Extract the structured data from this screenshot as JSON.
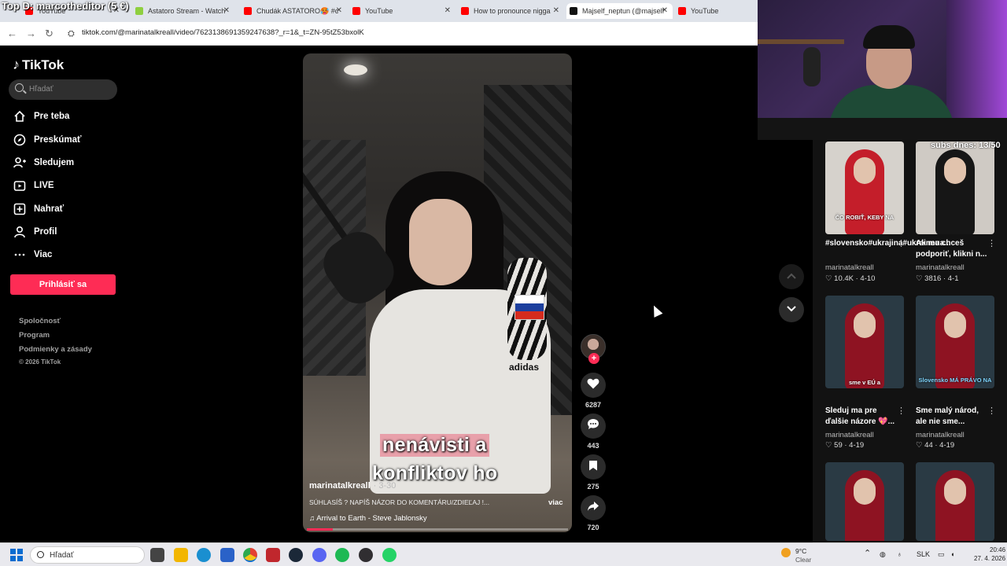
{
  "overlay": {
    "text": "Top D: marcotheditor (5 €)"
  },
  "browser": {
    "tabs": [
      {
        "title": "YouTube",
        "color": "#ff0000"
      },
      {
        "title": "Astatoro Stream - Watch",
        "color": "#8fcf3f"
      },
      {
        "title": "Chudák ASTATORO🥵 #c",
        "color": "#ff0000"
      },
      {
        "title": "YouTube",
        "color": "#ff0000"
      },
      {
        "title": "How to pronounce nigga",
        "color": "#ff0000"
      },
      {
        "title": "Majself_neptun (@majself",
        "color": "#111111"
      },
      {
        "title": "YouTube",
        "color": "#ff0000"
      }
    ],
    "close_glyph": "✕",
    "back_glyph": "←",
    "forward_glyph": "→",
    "reload_glyph": "↻",
    "url_icon_glyph": "⛭",
    "url": "tiktok.com/@marinatalkreall/video/7623138691359247638?_r=1&_t=ZN-95tZ53bxolK"
  },
  "sidebar": {
    "logo": "TikTok",
    "logo_glyph": "♪",
    "search_placeholder": "Hľadať",
    "nav": [
      {
        "label": "Pre teba",
        "icon": "home-icon"
      },
      {
        "label": "Preskúmať",
        "icon": "compass-icon"
      },
      {
        "label": "Sledujem",
        "icon": "following-icon"
      },
      {
        "label": "LIVE",
        "icon": "live-icon"
      },
      {
        "label": "Nahrať",
        "icon": "upload-icon"
      },
      {
        "label": "Profil",
        "icon": "profile-icon"
      },
      {
        "label": "Viac",
        "icon": "more-icon"
      }
    ],
    "login": "Prihlásiť sa",
    "footer": [
      "Spoločnosť",
      "Program",
      "Podmienky a zásady"
    ],
    "copyright": "© 2026 TikTok"
  },
  "video": {
    "caption_line1": "nenávisti a",
    "caption_line2": "konfliktov ho",
    "brand_text": "adidas",
    "author": "marinatalkreall",
    "date": "· 3-30",
    "description": "SÚHLASÍŠ ? NAPÍŠ NÁZOR DO KOMENTÁRU/ZDIEĽAJ !...",
    "more": "viac",
    "music": "♫  Arrival to Earth - Steve Jablonsky",
    "progress": 0.1
  },
  "actions": {
    "follow_glyph": "+",
    "likes": "6287",
    "comments": "443",
    "saves": "275",
    "shares": "720"
  },
  "related": [
    {
      "overlay": "ČO ROBIŤ, KEBY NA",
      "title": "#slovensko#ukrajina#ukraineua...",
      "author": "marinatalkreall",
      "likes": "♡ 10.4K",
      "date": "· 4-10",
      "bg": "#c41e2a"
    },
    {
      "overlay": "",
      "title": "Ak ma chceš podporiť, klikni n...",
      "author": "marinatalkreall",
      "likes": "♡ 3816",
      "date": "· 4-1",
      "bg": "#161616"
    },
    {
      "overlay": "sme v EÚ a",
      "title": "Sleduj ma pre ďalšie názore 💖...",
      "author": "marinatalkreall",
      "likes": "♡ 59",
      "date": "· 4-19",
      "bg": "#8e1322"
    },
    {
      "overlay": "Slovensko MÁ PRÁVO NA",
      "title": "Sme malý národ, ale nie sme...",
      "author": "marinatalkreall",
      "likes": "♡ 44",
      "date": "· 4-19",
      "bg": "#8e1322"
    },
    {
      "overlay": "",
      "title": "",
      "author": "",
      "likes": "",
      "date": "",
      "bg": "#8e1322"
    },
    {
      "overlay": "",
      "title": "",
      "author": "",
      "likes": "",
      "date": "",
      "bg": "#8e1322"
    }
  ],
  "kebab_glyph": "⋮",
  "subs_text": "subs dnes: 13/50",
  "taskbar": {
    "search_placeholder": "Hľadať",
    "apps": [
      {
        "name": "task-view",
        "color": "#444"
      },
      {
        "name": "file-explorer",
        "color": "#f2b600"
      },
      {
        "name": "edge",
        "color": "#1a8fd0"
      },
      {
        "name": "store",
        "color": "#2a62c8"
      },
      {
        "name": "chrome",
        "color": "#e34133"
      },
      {
        "name": "news-app",
        "color": "#c0272d"
      },
      {
        "name": "steam",
        "color": "#1b2838"
      },
      {
        "name": "discord",
        "color": "#5865f2"
      },
      {
        "name": "spotify",
        "color": "#1db954"
      },
      {
        "name": "obs",
        "color": "#302e31"
      },
      {
        "name": "whatsapp",
        "color": "#25d366"
      }
    ],
    "weather_temp": "9°C",
    "weather_desc": "Clear",
    "lang": "SLK",
    "time": "20:46",
    "date": "27. 4. 2026"
  }
}
